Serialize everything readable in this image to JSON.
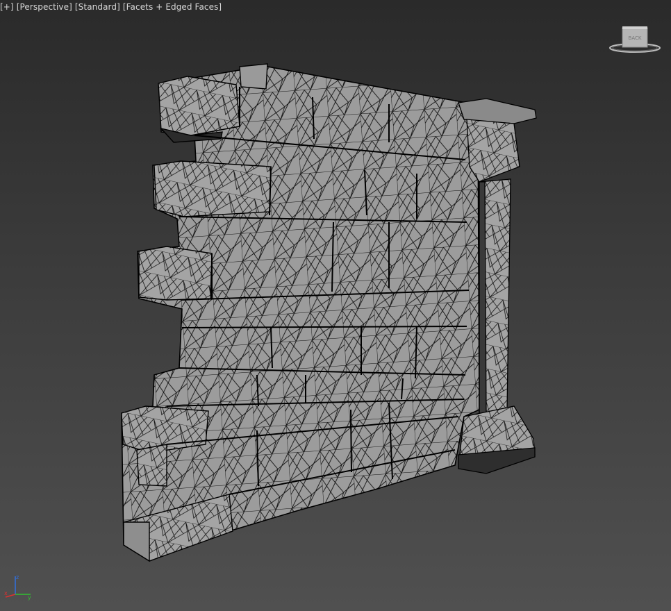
{
  "viewport": {
    "labels": [
      "[+]",
      "[Perspective]",
      "[Standard]",
      "[Facets + Edged Faces]"
    ]
  },
  "viewcube": {
    "icon": "viewcube-icon",
    "face_label": "BACK"
  },
  "axis_tripod": {
    "icon": "axis-tripod-icon",
    "x_color": "#e03030",
    "y_color": "#30c030",
    "z_color": "#3070e0"
  },
  "model": {
    "name": "",
    "shading": "Facets + Edged Faces",
    "face_color": "#9e9e9e",
    "edge_color": "#000000"
  }
}
